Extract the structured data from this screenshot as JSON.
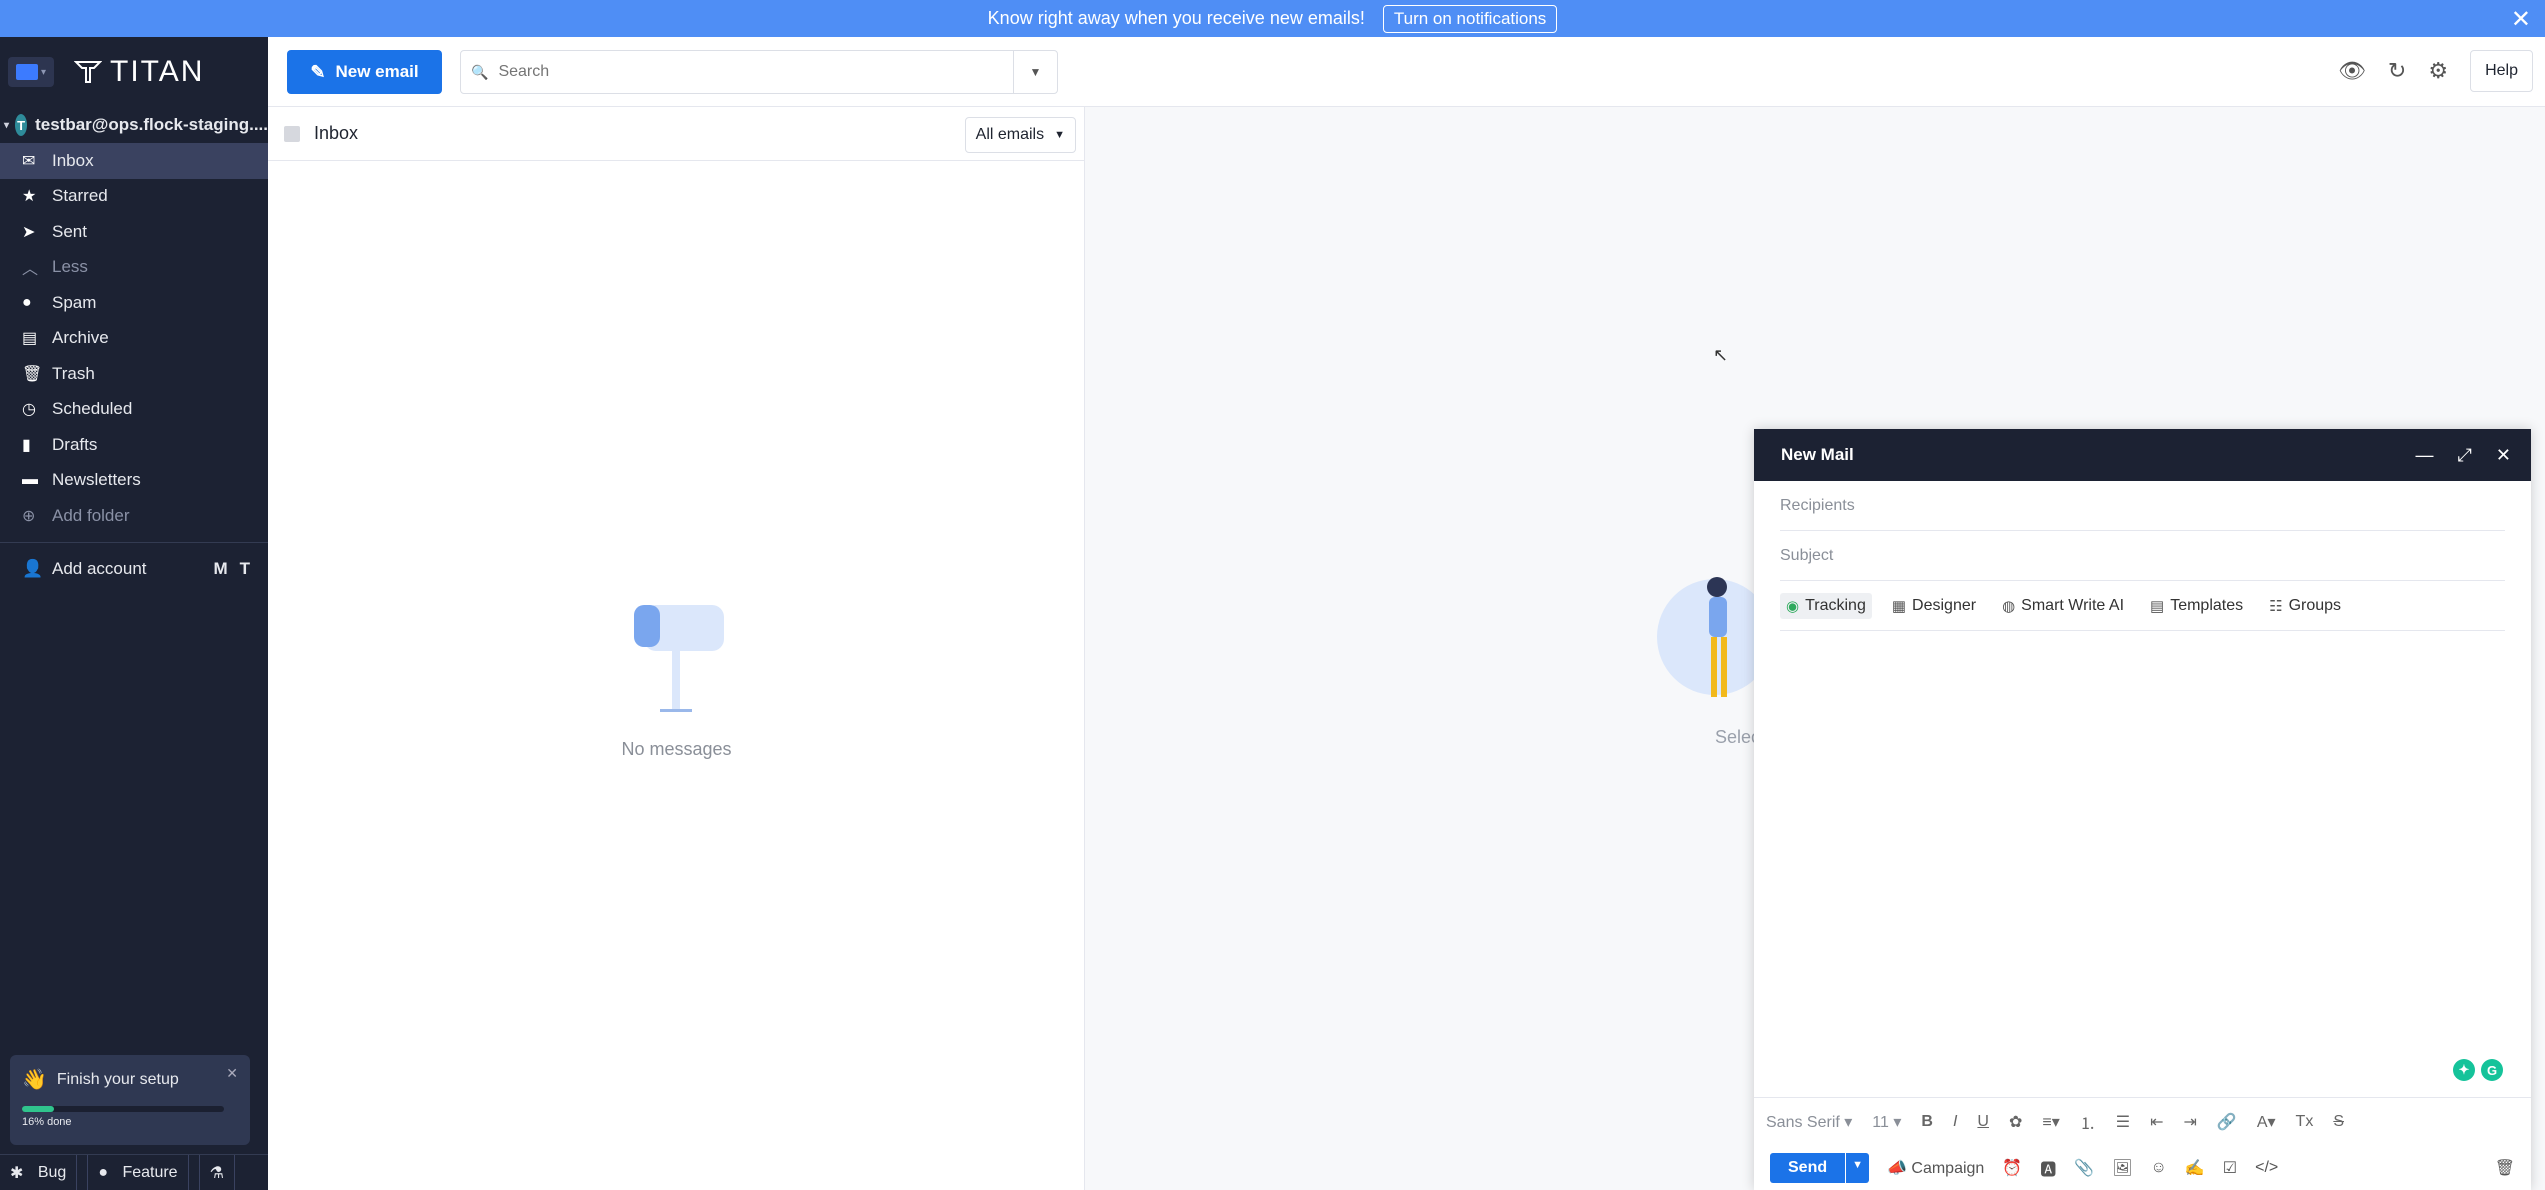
{
  "banner": {
    "message": "Know right away when you receive new emails!",
    "button": "Turn on notifications",
    "close": "✕"
  },
  "brand": {
    "name": "TITAN"
  },
  "account": {
    "email": "testbar@ops.flock-staging....",
    "initial": "T"
  },
  "folders": [
    {
      "label": "Inbox",
      "icon": "inbox-icon"
    },
    {
      "label": "Starred",
      "icon": "star-icon"
    },
    {
      "label": "Sent",
      "icon": "send-icon"
    },
    {
      "label": "Less",
      "icon": "chevron-up-icon"
    },
    {
      "label": "Spam",
      "icon": "spam-icon"
    },
    {
      "label": "Archive",
      "icon": "archive-icon"
    },
    {
      "label": "Trash",
      "icon": "trash-icon"
    },
    {
      "label": "Scheduled",
      "icon": "clock-icon"
    },
    {
      "label": "Drafts",
      "icon": "draft-icon"
    },
    {
      "label": "Newsletters",
      "icon": "folder-icon"
    },
    {
      "label": "Add folder",
      "icon": "plus-icon"
    }
  ],
  "add_account": {
    "label": "Add account"
  },
  "setup": {
    "title": "Finish your setup",
    "progress_label": "16% done",
    "progress": 0.16
  },
  "bottom": {
    "bug": "Bug",
    "feature": "Feature"
  },
  "toolbar": {
    "new_email": "New email",
    "search_placeholder": "Search",
    "help": "Help"
  },
  "list": {
    "title": "Inbox",
    "filter": "All emails",
    "empty": "No messages"
  },
  "reading": {
    "select_text": "Selec"
  },
  "compose": {
    "title": "New Mail",
    "recipients_placeholder": "Recipients",
    "subject_placeholder": "Subject",
    "tools": [
      "Tracking",
      "Designer",
      "Smart Write AI",
      "Templates",
      "Groups"
    ],
    "font": "Sans Serif",
    "size": "11",
    "send": "Send",
    "campaign": "Campaign"
  },
  "colors": {
    "banner": "#4f8ef5",
    "sidebar": "#1c2233",
    "accent": "#1b73e8",
    "progress": "#30c48d"
  }
}
